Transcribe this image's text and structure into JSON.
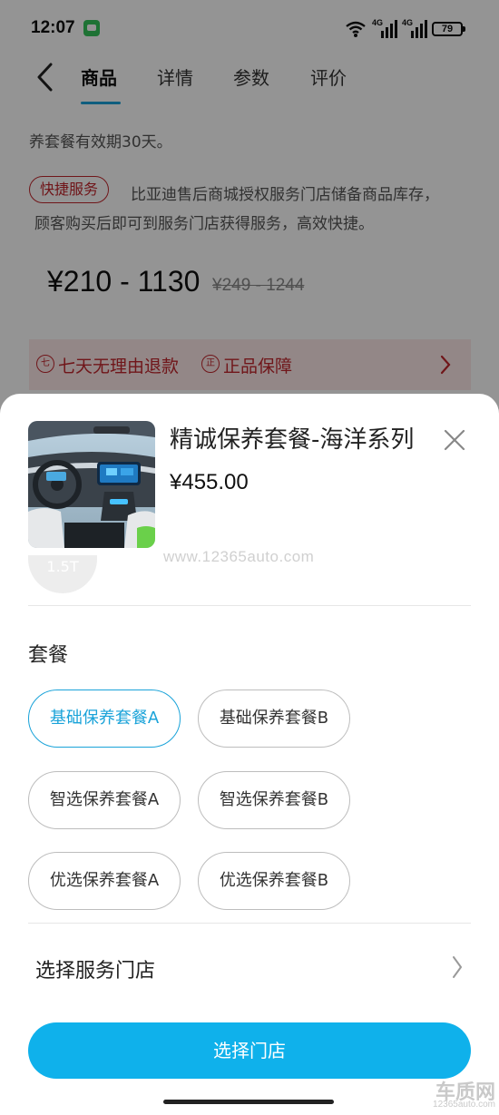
{
  "status_bar": {
    "time": "12:07",
    "network_1": "4G",
    "network_2": "4G",
    "battery": "79"
  },
  "nav": {
    "tabs": [
      {
        "label": "商品",
        "active": true
      },
      {
        "label": "详情",
        "active": false
      },
      {
        "label": "参数",
        "active": false
      },
      {
        "label": "评价",
        "active": false
      }
    ]
  },
  "background": {
    "validity_text": "养套餐有效期30天。",
    "fast_service_badge": "快捷服务",
    "service_description_line1": "比亚迪售后商城授权服务门店储备商品库存，",
    "service_description_line2": "顾客购买后即可到服务门店获得服务，高效快捷。",
    "price_range": "¥210 - 1130",
    "original_price_range": "¥249 - 1244",
    "guarantees": [
      "七天无理由退款",
      "正品保障"
    ],
    "guarantee_icons": [
      "七",
      "正"
    ]
  },
  "sheet": {
    "product_title": "精诚保养套餐-海洋系列",
    "product_price": "¥455.00",
    "watermark": "www.12365auto.com",
    "partial_chip_text": "1.5T",
    "package_section_title": "套餐",
    "options": [
      {
        "label": "基础保养套餐A",
        "selected": true
      },
      {
        "label": "基础保养套餐B",
        "selected": false
      },
      {
        "label": "智选保养套餐A",
        "selected": false
      },
      {
        "label": "智选保养套餐B",
        "selected": false
      },
      {
        "label": "优选保养套餐A",
        "selected": false
      },
      {
        "label": "优选保养套餐B",
        "selected": false
      }
    ],
    "store_row_label": "选择服务门店",
    "select_store_button": "选择门店"
  },
  "corner_logo": {
    "name": "车质网",
    "url": "12365auto.com"
  },
  "colors": {
    "accent": "#0fb1eb",
    "selected_border": "#1aa3d9",
    "warning_red": "#c1272d",
    "guarantee_bg": "#fde8e8"
  }
}
